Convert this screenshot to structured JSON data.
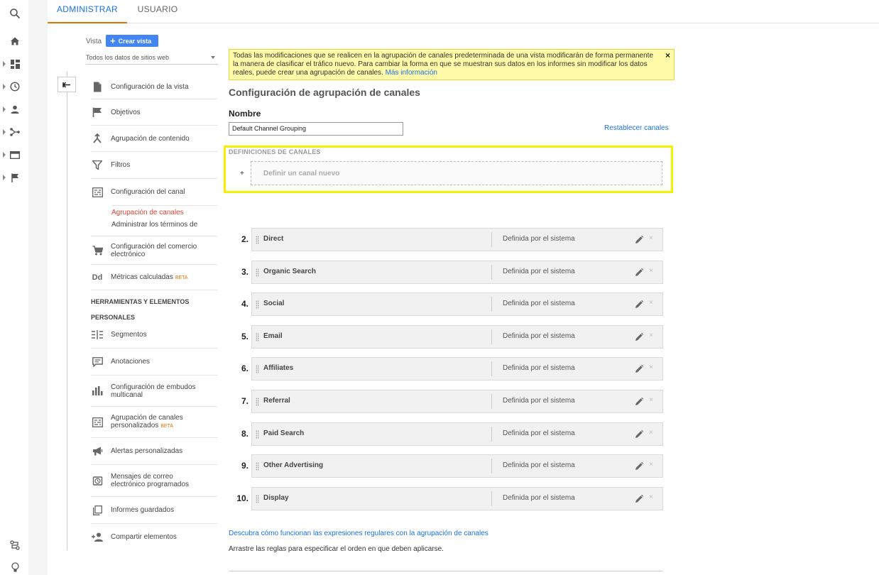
{
  "tabs": [
    {
      "label": "ADMINISTRAR"
    },
    {
      "label": "USUARIO"
    }
  ],
  "view": {
    "label": "Vista",
    "create_button": "Crear vista",
    "selected": "Todos los datos de sitios web"
  },
  "nav": {
    "items": [
      {
        "label": "Configuración de la vista"
      },
      {
        "label": "Objetivos"
      },
      {
        "label": "Agrupación de contenido"
      },
      {
        "label": "Filtros"
      },
      {
        "label": "Configuración del canal"
      },
      {
        "label": "Configuración del comercio electrónico"
      },
      {
        "label": "Métricas calculadas",
        "badge": "BETA"
      }
    ],
    "sub_items": [
      {
        "label": "Agrupación de canales"
      },
      {
        "label": "Administrar los términos de"
      }
    ],
    "section_title_1": "HERRAMIENTAS Y ELEMENTOS",
    "section_title_2": "PERSONALES",
    "tools": [
      {
        "label": "Segmentos"
      },
      {
        "label": "Anotaciones"
      },
      {
        "label": "Configuración de embudos multicanal"
      },
      {
        "label": "Agrupación de canales personalizados",
        "badge": "BETA"
      },
      {
        "label": "Alertas personalizadas"
      },
      {
        "label": "Mensajes de correo electrónico programados"
      },
      {
        "label": "Informes guardados"
      },
      {
        "label": "Compartir elementos"
      }
    ]
  },
  "notice": {
    "text": "Todas las modificaciones que se realicen en la agrupación de canales predeterminada de una vista modificarán de forma permanente la manera de clasificar el tráfico nuevo. Para cambiar la forma en que se muestran sus datos en los informes sin modificar los datos reales, puede crear una agrupación de canales. ",
    "link": "Más información",
    "close": "×"
  },
  "main": {
    "title": "Configuración de agrupación de canales",
    "name_label": "Nombre",
    "name_value": "Default Channel Grouping",
    "reset_link": "Restablecer canales",
    "defs_title": "DEFINICIONES DE CANALES",
    "add_symbol": "+",
    "define_new": "Definir un canal nuevo"
  },
  "channels": [
    {
      "num": "2.",
      "name": "Direct",
      "type": "Definida por el sistema"
    },
    {
      "num": "3.",
      "name": "Organic Search",
      "type": "Definida por el sistema"
    },
    {
      "num": "4.",
      "name": "Social",
      "type": "Definida por el sistema"
    },
    {
      "num": "5.",
      "name": "Email",
      "type": "Definida por el sistema"
    },
    {
      "num": "6.",
      "name": "Affiliates",
      "type": "Definida por el sistema"
    },
    {
      "num": "7.",
      "name": "Referral",
      "type": "Definida por el sistema"
    },
    {
      "num": "8.",
      "name": "Paid Search",
      "type": "Definida por el sistema"
    },
    {
      "num": "9.",
      "name": "Other Advertising",
      "type": "Definida por el sistema"
    },
    {
      "num": "10.",
      "name": "Display",
      "type": "Definida por el sistema"
    }
  ],
  "footer": {
    "link": "Descubra cómo funcionan las expresiones regulares con la agrupación de canales",
    "text": "Arrastre las reglas para especificar el orden en que deben aplicarse."
  },
  "icons": {
    "left_bar": [
      "search-icon",
      "home-icon",
      "dashboard-icon",
      "clock-icon",
      "person-icon",
      "acquisition-icon",
      "behavior-icon",
      "flag-icon",
      "attribution-icon",
      "lightbulb-icon"
    ],
    "delete_symbol": "×"
  },
  "colors": {
    "accent_blue": "#1a73e8",
    "tab_underline": "#e37400",
    "active_sub": "#db4437",
    "highlight": "#f5f000",
    "notice_bg": "#fffaa7"
  }
}
